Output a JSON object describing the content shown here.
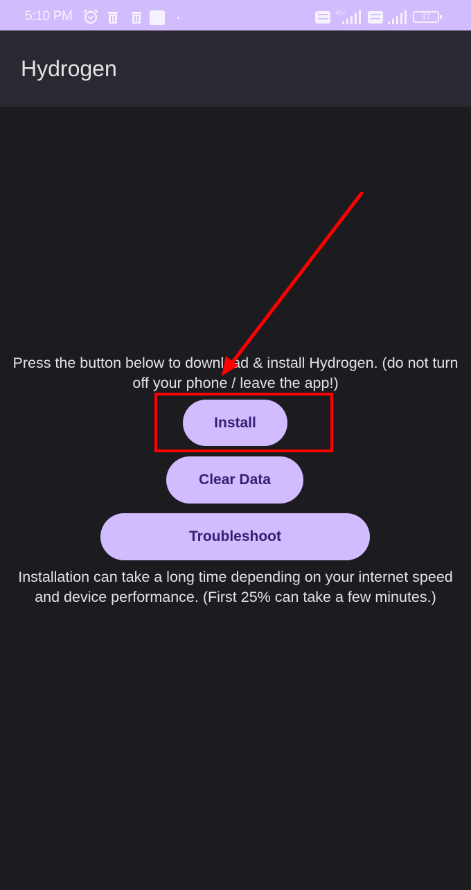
{
  "status_bar": {
    "time": "5:10 PM",
    "icons": [
      "alarm-icon",
      "delete-icon",
      "delete-icon",
      "notification-square-icon",
      "dot-icon",
      "volte-icon",
      "signal-4g-icon",
      "volte-icon",
      "signal-icon",
      "battery-icon"
    ],
    "network_label": "4G+",
    "volte_label": "Vo LTE",
    "battery_level": "37"
  },
  "app_bar": {
    "title": "Hydrogen"
  },
  "main": {
    "instruction_text": "Press the button below to download & install Hydrogen. (do not turn off your phone / leave the app!)",
    "buttons": {
      "install": "Install",
      "clear_data": "Clear Data",
      "troubleshoot": "Troubleshoot"
    },
    "note_text": "Installation can take a long time depending on your internet speed and device performance. (First 25% can take a few minutes.)"
  },
  "annotation": {
    "color": "#ff0000",
    "target": "Install"
  },
  "colors": {
    "accent": "#d0bcff",
    "on_accent": "#381e72",
    "background": "#1c1b1f",
    "app_bar": "#2b2930",
    "text": "#e6e1e5"
  }
}
